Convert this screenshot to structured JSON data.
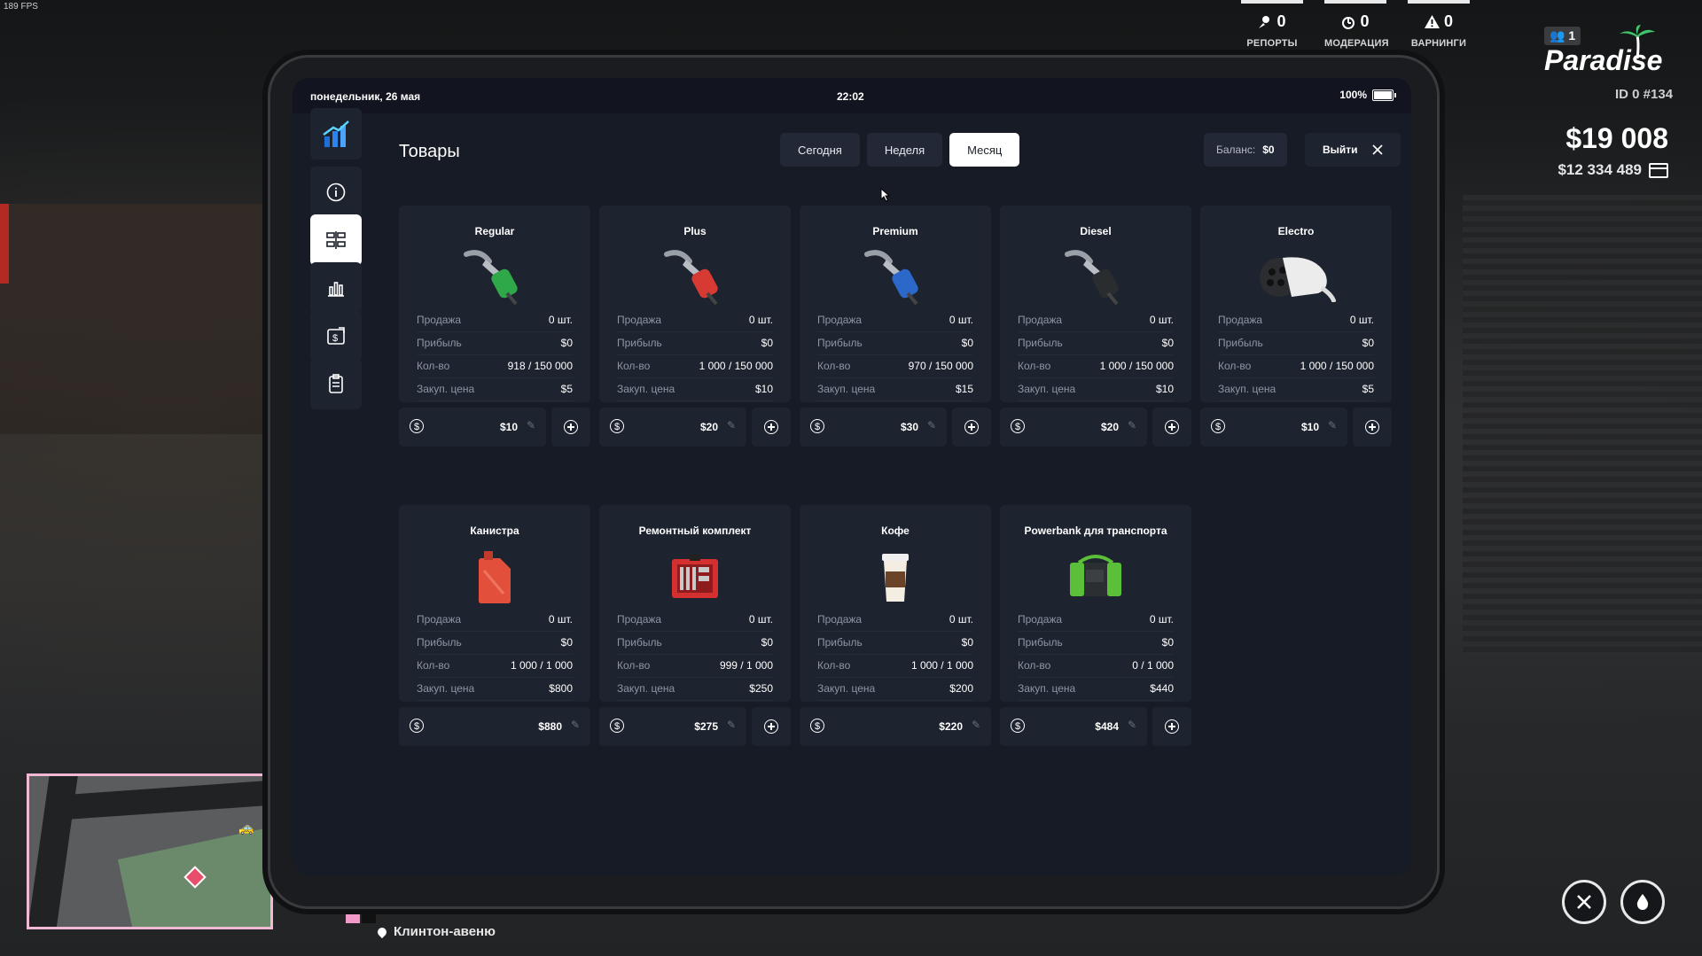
{
  "fps": "189 FPS",
  "hud": {
    "stats": [
      {
        "icon": "reports-icon",
        "value": "0",
        "label": "РЕПОРТЫ"
      },
      {
        "icon": "moderation-icon",
        "value": "0",
        "label": "МОДЕРАЦИЯ"
      },
      {
        "icon": "warning-icon",
        "value": "0",
        "label": "ВАРНИНГИ"
      }
    ],
    "online": "1",
    "logo": "Paradise",
    "player_id": "ID 0 #134",
    "cash": "$19 008",
    "bank": "$12 334 489"
  },
  "minimap": {
    "street": "Клинтон-авеню"
  },
  "tablet": {
    "status": {
      "date": "понедельник, 26 мая",
      "time": "22:02",
      "battery": "100%"
    },
    "title": "Товары",
    "tabs": [
      {
        "label": "Сегодня"
      },
      {
        "label": "Неделя"
      },
      {
        "label": "Месяц",
        "active": true
      }
    ],
    "balance": {
      "label": "Баланс:",
      "value": "$0"
    },
    "exit_label": "Выйти",
    "sidebar": [
      "stats-logo-icon",
      "info-icon",
      "products-icon",
      "chart-icon",
      "money-exchange-icon",
      "clipboard-icon"
    ],
    "row_labels": {
      "sales": "Продажа",
      "profit": "Прибыль",
      "qty": "Кол-во",
      "buy": "Закуп. цена"
    },
    "products": [
      {
        "name": "Regular",
        "sales": "0 шт.",
        "profit": "$0",
        "qty": "918 / 150 000",
        "buy": "$5",
        "price": "$10",
        "icon": "green-fuel-nozzle-icon",
        "color": "#2fa84a",
        "addable": true
      },
      {
        "name": "Plus",
        "sales": "0 шт.",
        "profit": "$0",
        "qty": "1 000 / 150 000",
        "buy": "$10",
        "price": "$20",
        "icon": "red-fuel-nozzle-icon",
        "color": "#d73a33",
        "addable": true
      },
      {
        "name": "Premium",
        "sales": "0 шт.",
        "profit": "$0",
        "qty": "970 / 150 000",
        "buy": "$15",
        "price": "$30",
        "icon": "blue-fuel-nozzle-icon",
        "color": "#2c68c9",
        "addable": true
      },
      {
        "name": "Diesel",
        "sales": "0 шт.",
        "profit": "$0",
        "qty": "1 000 / 150 000",
        "buy": "$10",
        "price": "$20",
        "icon": "black-fuel-nozzle-icon",
        "color": "#2a2d2f",
        "addable": true
      },
      {
        "name": "Electro",
        "sales": "0 шт.",
        "profit": "$0",
        "qty": "1 000 / 150 000",
        "buy": "$5",
        "price": "$10",
        "icon": "ev-charger-icon",
        "color": "#e8e8e8",
        "addable": true
      },
      {
        "name": "Канистра",
        "sales": "0 шт.",
        "profit": "$0",
        "qty": "1 000 / 1 000",
        "buy": "$800",
        "price": "$880",
        "icon": "jerrycan-icon",
        "color": "#e2503c",
        "addable": false
      },
      {
        "name": "Ремонтный комплект",
        "sales": "0 шт.",
        "profit": "$0",
        "qty": "999 / 1 000",
        "buy": "$250",
        "price": "$275",
        "icon": "repair-kit-icon",
        "color": "#d3302f",
        "addable": true
      },
      {
        "name": "Кофе",
        "sales": "0 шт.",
        "profit": "$0",
        "qty": "1 000 / 1 000",
        "buy": "$200",
        "price": "$220",
        "icon": "coffee-cup-icon",
        "color": "#8a5a3a",
        "addable": false
      },
      {
        "name": "Powerbank для транспорта",
        "sales": "0 шт.",
        "profit": "$0",
        "qty": "0 / 1 000",
        "buy": "$440",
        "price": "$484",
        "icon": "powerbank-icon",
        "color": "#5cbf3a",
        "addable": true
      }
    ]
  }
}
